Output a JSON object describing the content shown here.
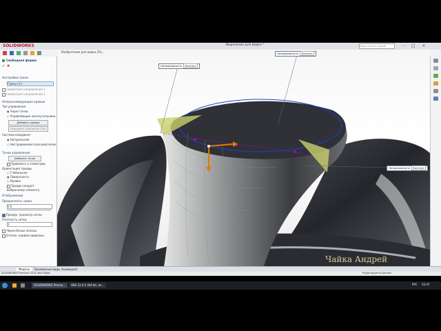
{
  "app": {
    "logo": "SOLIDWORKS",
    "doc_title": "Вырезание для видео *",
    "search_placeholder": "Поиск в базе знаний",
    "window_controls": "– □ ×"
  },
  "breadcrumb": {
    "part_label": "Изобретение для видео (По..."
  },
  "panel": {
    "title": "Свободная форма",
    "section_face": "Настройки грани",
    "face_value": "Грань<1>",
    "check_dir1": "Симметрия направления 1",
    "check_dir2": "Симметрия направления 2",
    "section_curves": "Аппроксимирующие кривые",
    "control_type_label": "Тип управления",
    "radio_through_points": "Через точки",
    "radio_control_polygon": "Управляющие многоугольники",
    "add_curves_button": "Добавить кривые",
    "reverse_button": "Направить изменение (Tab)",
    "coord_system_label": "Система координат",
    "radio_natural": "Натуральная",
    "radio_user": "Настраиваемая пользователем",
    "section_points": "Точки управления",
    "add_points_button": "Добавить точки",
    "snap_label": "Привязать к геометрии",
    "triad_label": "Ориентация триады",
    "radio_global": "Глобальная",
    "radio_surface": "Поверхность",
    "radio_curve": "Кривая",
    "follow_selection": "Триада следует выбранному элементу",
    "section_display": "Отображение",
    "transparency_label": "Прозрачность грани",
    "transparency_value": "0.0",
    "mesh_preview_check": "Предпр. просмотр сетки",
    "mesh_density_label": "Плотность сетки",
    "mesh_density_value": "3",
    "zebra_check": "Черно-белые полосы",
    "curvature_check": "Отклон. кривой кривизны"
  },
  "callouts": [
    {
      "label": "Непрерывность",
      "value": "Контакт"
    },
    {
      "label": "Непрерывность",
      "value": "Контакт"
    },
    {
      "label": "Непрерывность",
      "value": "Контакт"
    }
  ],
  "tabs": [
    "Модель",
    "Трехмерные виды",
    "Анимация1"
  ],
  "status": {
    "left": "SOLIDWORKS Premium 2015 x64 Edition",
    "right": "Редактируется Деталь"
  },
  "taskbar": {
    "items": [
      "SOLIDWORKS Premiu...",
      "OBS 22.0.2 (64-bit, wi..."
    ],
    "lang": "РУС",
    "time": "23:47"
  },
  "watermark": "Чайка Андрей",
  "colors": {
    "brand": "#c0152f",
    "model_shade": "#2d2f35",
    "highlight": "#c9d16a",
    "curve": "#b000c0"
  }
}
